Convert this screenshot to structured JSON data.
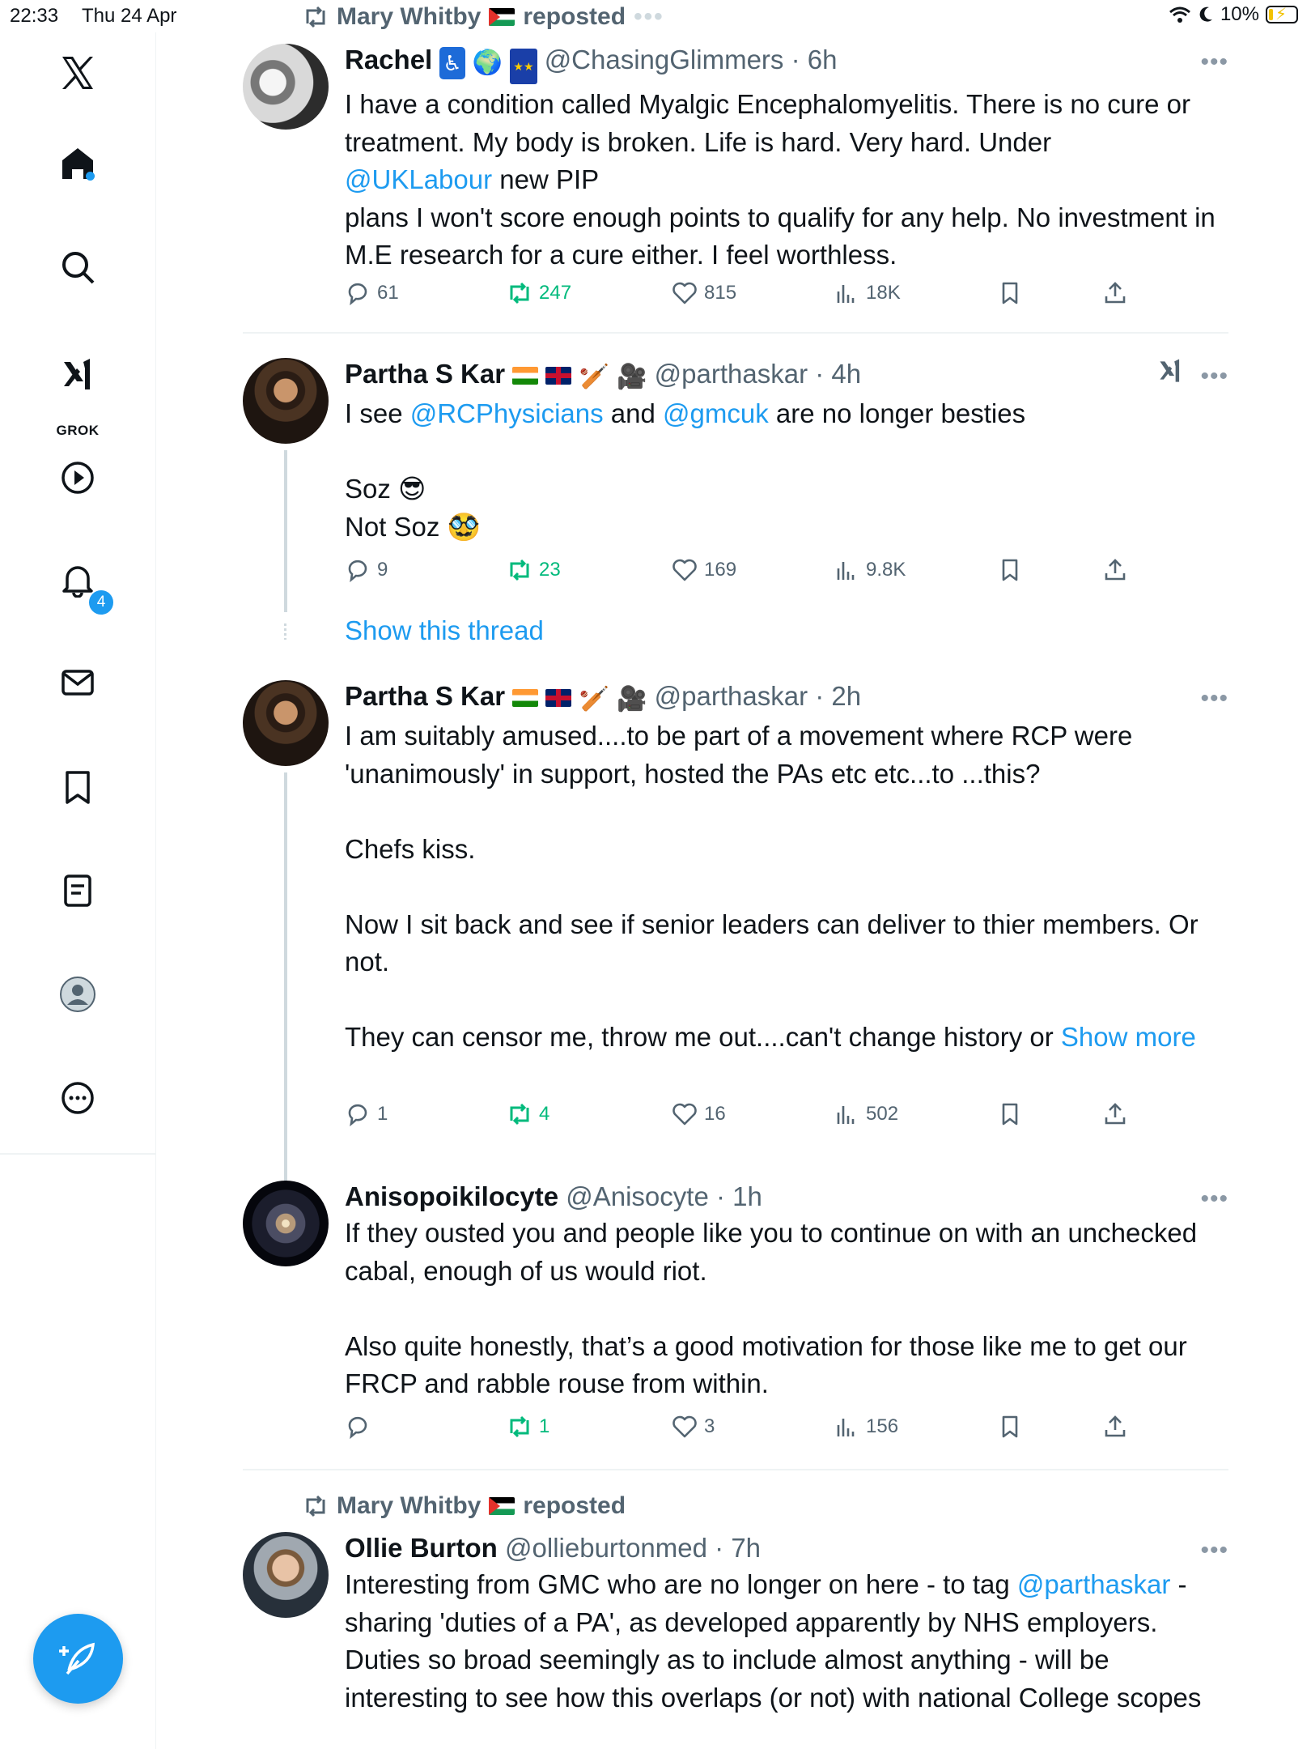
{
  "status_bar": {
    "time": "22:33",
    "date": "Thu 24 Apr",
    "battery": "10%"
  },
  "sidebar": {
    "grok_label": "GROK",
    "notifications_count": "4"
  },
  "top_repost": {
    "who": "Mary Whitby",
    "label": "reposted"
  },
  "tweets": [
    {
      "name": "Rachel",
      "handle": "@ChasingGlimmers",
      "time": "6h",
      "text_before_link": "I have a condition called Myalgic Encephalomyelitis. There is no cure or treatment. My body is broken. Life is hard. Very hard. Under",
      "link": "@UKLabour",
      "text_after_link": " new PIP\nplans I won't score enough points to qualify for any help. No investment in M.E research for a cure either. I feel worthless.",
      "replies": "61",
      "reposts": "247",
      "likes": "815",
      "views": "18K"
    },
    {
      "name": "Partha S Kar",
      "handle": "@parthaskar",
      "time": "4h",
      "t1": "I see ",
      "l1": "@RCPhysicians",
      "t2": " and ",
      "l2": "@gmcuk",
      "t3": " are no longer besties",
      "line_soz": "Soz",
      "line_notsoz": "Not Soz",
      "replies": "9",
      "reposts": "23",
      "likes": "169",
      "views": "9.8K"
    },
    {
      "show_thread": "Show this thread",
      "name": "Partha S Kar",
      "handle": "@parthaskar",
      "time": "2h",
      "text": "I am suitably amused....to be part of a movement where RCP were 'unanimously' in support, hosted the PAs etc etc...to ...this?\n\nChefs kiss.\n\nNow I sit back and see if senior leaders can deliver to thier members. Or not.\n\nThey can censor me, throw me out....can't change history or ",
      "show_more": "Show more",
      "replies": "1",
      "reposts": "4",
      "likes": "16",
      "views": "502"
    },
    {
      "name": "Anisopoikilocyte",
      "handle": "@Anisocyte",
      "time": "1h",
      "text": "If they ousted you and people like you to continue on with an unchecked cabal, enough of us would riot.\n\nAlso quite honestly, that’s a good motivation for those like me to get our FRCP and rabble rouse from within.",
      "replies": "",
      "reposts": "1",
      "likes": "3",
      "views": "156"
    },
    {
      "repost_who": "Mary Whitby",
      "repost_label": "reposted",
      "name": "Ollie Burton",
      "handle": "@ollieburtonmed",
      "time": "7h",
      "t1": "Interesting from GMC who are no longer on here - to tag ",
      "l1": "@parthaskar",
      "t2": " - sharing 'duties of a PA', as developed apparently by NHS employers. Duties so broad seemingly as to include almost anything - will be interesting to see how this overlaps (or not) with national College scopes"
    }
  ]
}
